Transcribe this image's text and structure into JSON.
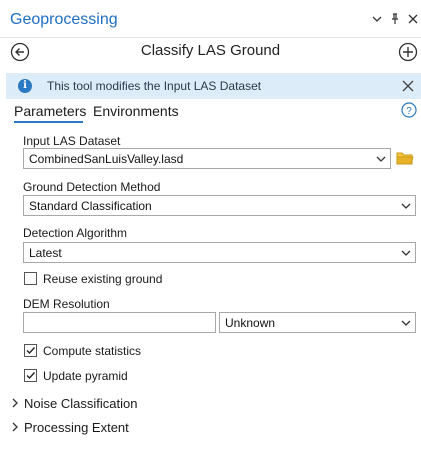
{
  "titlebar": {
    "title": "Geoprocessing"
  },
  "tool": {
    "title": "Classify LAS Ground"
  },
  "info": {
    "message": "This tool modifies the Input LAS Dataset"
  },
  "tabs": [
    {
      "label": "Parameters"
    },
    {
      "label": "Environments"
    }
  ],
  "params": {
    "input_las": {
      "label": "Input LAS Dataset",
      "value": "CombinedSanLuisValley.lasd"
    },
    "ground_method": {
      "label": "Ground Detection Method",
      "value": "Standard Classification"
    },
    "detection_algorithm": {
      "label": "Detection Algorithm",
      "value": "Latest"
    },
    "reuse_ground": {
      "label": "Reuse existing ground",
      "checked": false
    },
    "dem_resolution": {
      "label": "DEM Resolution",
      "value": "",
      "unit": "Unknown"
    },
    "compute_statistics": {
      "label": "Compute statistics",
      "checked": true
    },
    "update_pyramid": {
      "label": "Update pyramid",
      "checked": true
    }
  },
  "sections": [
    {
      "label": "Noise Classification"
    },
    {
      "label": "Processing Extent"
    }
  ],
  "colors": {
    "accent": "#1f6ec1",
    "info_bg": "#dcedf9",
    "folder": "#e0a800"
  },
  "icons": {
    "back": "back-arrow-icon",
    "add": "add-circle-icon",
    "info": "info-icon",
    "help": "help-icon",
    "folder": "folder-icon",
    "chevron": "chevron-down-icon",
    "expand": "chevron-right-icon"
  }
}
